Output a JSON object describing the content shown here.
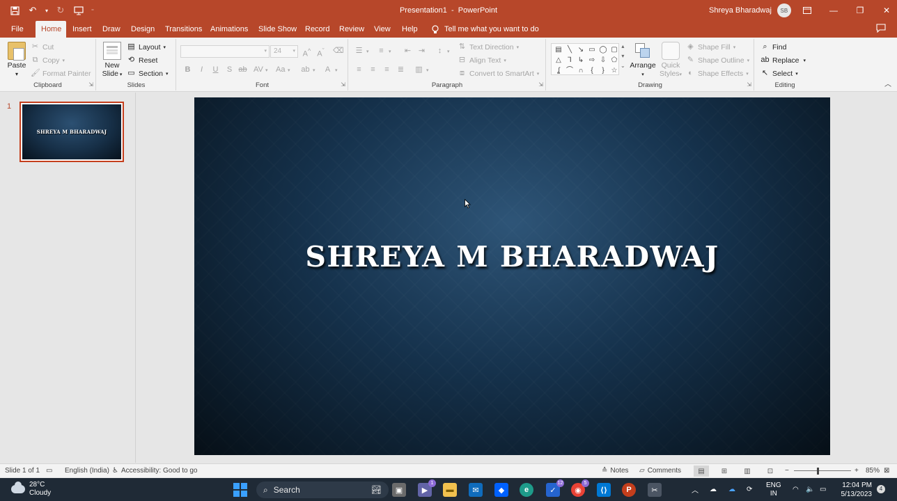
{
  "window": {
    "doc_title": "Presentation1",
    "separator": "-",
    "app_name": "PowerPoint",
    "user_name": "Shreya Bharadwaj",
    "user_initials": "SB"
  },
  "tabs": [
    "File",
    "Home",
    "Insert",
    "Draw",
    "Design",
    "Transitions",
    "Animations",
    "Slide Show",
    "Record",
    "Review",
    "View",
    "Help"
  ],
  "active_tab": "Home",
  "tell_me": "Tell me what you want to do",
  "ribbon": {
    "clipboard": {
      "label": "Clipboard",
      "paste": "Paste",
      "cut": "Cut",
      "copy": "Copy",
      "format_painter": "Format Painter"
    },
    "slides": {
      "label": "Slides",
      "new_slide_1": "New",
      "new_slide_2": "Slide",
      "layout": "Layout",
      "reset": "Reset",
      "section": "Section"
    },
    "font": {
      "label": "Font",
      "font_size": "24"
    },
    "paragraph": {
      "label": "Paragraph",
      "text_direction": "Text Direction",
      "align_text": "Align Text",
      "convert_smartart": "Convert to SmartArt"
    },
    "drawing": {
      "label": "Drawing",
      "arrange": "Arrange",
      "quick_1": "Quick",
      "quick_2": "Styles",
      "shape_fill": "Shape Fill",
      "shape_outline": "Shape Outline",
      "shape_effects": "Shape Effects"
    },
    "editing": {
      "label": "Editing",
      "find": "Find",
      "replace": "Replace",
      "select": "Select"
    }
  },
  "thumbnails": [
    {
      "number": "1",
      "title": "SHREYA M BHARADWAJ"
    }
  ],
  "slide": {
    "title": "SHREYA M BHARADWAJ"
  },
  "status": {
    "slide_info": "Slide 1 of 1",
    "language": "English (India)",
    "accessibility": "Accessibility: Good to go",
    "notes": "Notes",
    "comments": "Comments",
    "zoom": "85%"
  },
  "taskbar": {
    "temperature": "28°C",
    "weather": "Cloudy",
    "search": "Search",
    "teams_badge": "1",
    "todo_badge": "12",
    "chrome_badge": "5",
    "lang_1": "ENG",
    "lang_2": "IN",
    "time": "12:04 PM",
    "date": "5/13/2023",
    "notifications": "4"
  }
}
